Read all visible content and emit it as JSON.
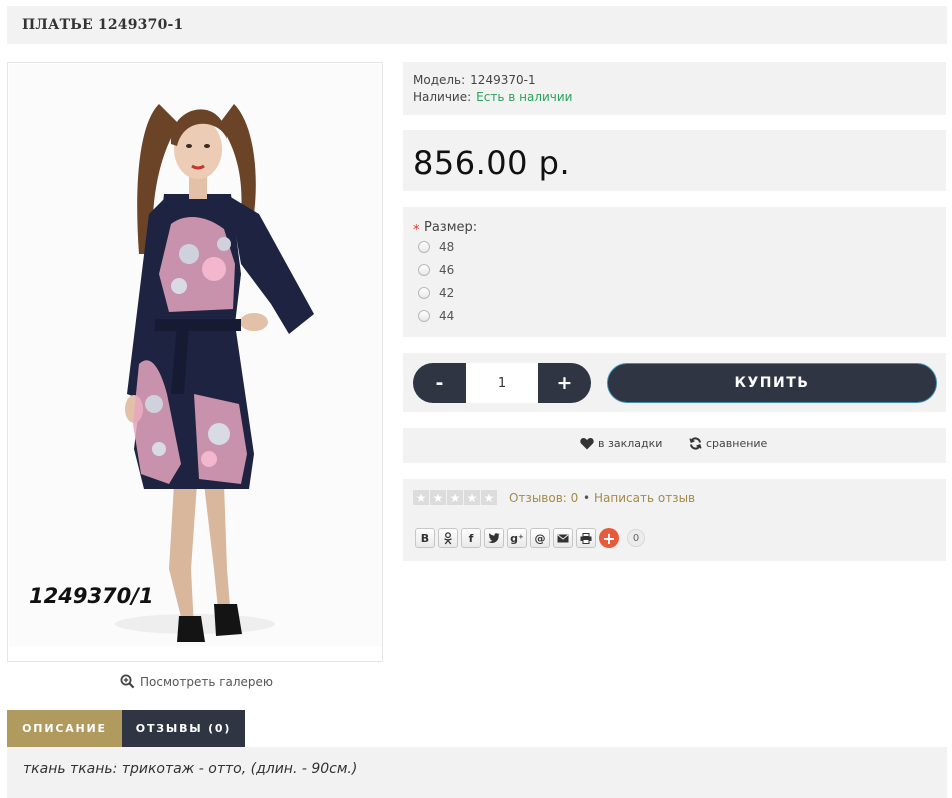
{
  "product": {
    "title": "ПЛАТЬЕ 1249370-1",
    "image_caption": "1249370/1",
    "gallery_link": "Посмотреть галерею"
  },
  "info": {
    "model_label": "Модель:",
    "model_value": "1249370-1",
    "stock_label": "Наличие:",
    "stock_value": "Есть в наличии"
  },
  "price": "856.00 р.",
  "options": {
    "required_mark": "*",
    "title": "Размер:",
    "sizes": [
      "48",
      "46",
      "42",
      "44"
    ]
  },
  "cart": {
    "minus": "-",
    "quantity": "1",
    "plus": "+",
    "buy_label": "КУПИТЬ"
  },
  "links": {
    "wishlist": "в закладки",
    "compare": "сравнение"
  },
  "rating": {
    "stars_filled": 0,
    "stars_total": 5,
    "reviews_link": "Отзывов: 0",
    "separator": "•",
    "write_review": "Написать отзыв"
  },
  "share": {
    "buttons": [
      "В",
      "ok-icon",
      "facebook-icon",
      "twitter-icon",
      "g+",
      "@",
      "mail-icon",
      "print-icon"
    ],
    "button_labels": [
      "В",
      "ꝋ",
      "f",
      "t",
      "g⁺",
      "@",
      "✉",
      "⎙"
    ],
    "plus": "+",
    "count": "0"
  },
  "tabs": {
    "description": "ОПИСАНИЕ",
    "reviews": "ОТЗЫВЫ (0)"
  },
  "description_text": "ткань ткань: трикотаж - отто,  (длин. - 90см.)",
  "colors": {
    "dark": "#2f3543",
    "gold": "#b09a5e",
    "stock_green": "#2aa35a",
    "link_gold": "#a58a4a",
    "panel_bg": "#f2f2f2"
  }
}
